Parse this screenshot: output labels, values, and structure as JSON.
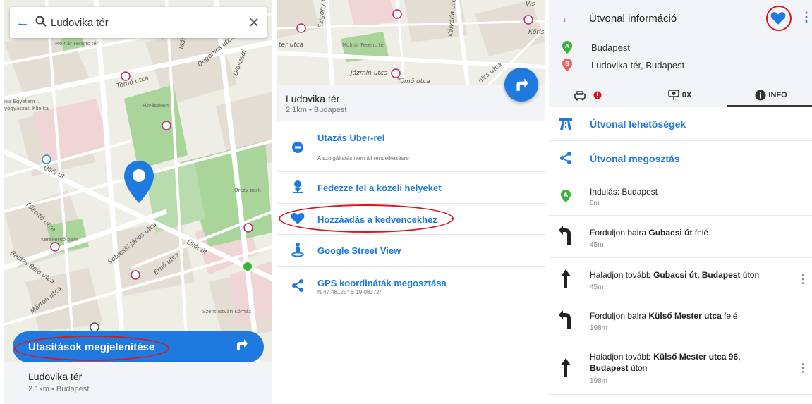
{
  "colors": {
    "accent": "#1f7ae0",
    "highlight": "#e0141c",
    "marker_a": "#3bb33b",
    "marker_b": "#f0605e"
  },
  "panel1": {
    "search": {
      "query": "Ludovika tér",
      "back_icon": "arrow-left-icon",
      "search_icon": "magnifier-icon",
      "clear_icon": "close-icon"
    },
    "map_labels": {
      "streets": [
        "Illés utca",
        "Dugonics utca",
        "Diószegi",
        "Tömő utca",
        "Üllői út",
        "Tűzoltó utca",
        "Balázs Béla utca",
        "Sobieski János utca",
        "Ernő utca",
        "Márton utca",
        "Üllői út",
        "Mária utca"
      ],
      "pois": [
        "Molnár Ferenc tér",
        "Füvészkert",
        "Orczy park",
        "Kerekerdő park",
        "Szent István Kórház",
        "ika Egyetem I.",
        "yógyászati Klinika"
      ]
    },
    "cta_label": "Utasítások megjelenítése",
    "cta_icon": "turn-right-icon",
    "place": {
      "title": "Ludovika tér",
      "subtitle": "2.1km • Budapest"
    }
  },
  "panel2": {
    "map_labels": [
      "Szigony u",
      "Kőris",
      "Vis",
      "ter utca",
      "Molnár Ferenc tér",
      "Kálvária utca",
      "Jázmin utca",
      "Tömő utca",
      "olcs utca"
    ],
    "place": {
      "title": "Ludovika tér",
      "subtitle": "2.1km • Budapest"
    },
    "fab_icon": "turn-right-icon",
    "menu": [
      {
        "label": "Utazás Uber-rel",
        "sub": "A szolgáltatás nem áll rendelkezésre",
        "icon": "uber-icon"
      },
      {
        "label": "Fedezze fel a közeli helyeket",
        "sub": "",
        "icon": "person-pin-icon"
      },
      {
        "label": "Hozzáadás a kedvencekhez",
        "sub": "",
        "icon": "heart-icon"
      },
      {
        "label": "Google Street View",
        "sub": "",
        "icon": "street-view-icon"
      },
      {
        "label": "GPS koordináták megosztása",
        "sub": "N 47.48125° E 19.08372°",
        "icon": "share-icon"
      }
    ]
  },
  "panel3": {
    "title": "Útvonal információ",
    "from": {
      "marker": "A",
      "text": "Budapest"
    },
    "to": {
      "marker": "B",
      "text": "Ludovika tér, Budapest"
    },
    "tabs": [
      {
        "icon": "car-traffic-icon",
        "badge_icon": "alert-icon"
      },
      {
        "icon": "speed-camera-icon",
        "label": "0X"
      },
      {
        "icon": "info-icon",
        "label": "INFO"
      }
    ],
    "options": [
      {
        "label": "Útvonal lehetőségek",
        "icon": "highway-icon"
      },
      {
        "label": "Útvonal megosztás",
        "icon": "share-icon"
      }
    ],
    "steps": [
      {
        "pre": "Indulás: Budapest",
        "bold": "",
        "post": "",
        "dist": "0m",
        "icon": "marker-a-icon"
      },
      {
        "pre": "Forduljon balra ",
        "bold": "Gubacsi út",
        "post": " felé",
        "dist": "45m",
        "icon": "turn-left-icon"
      },
      {
        "pre": "Haladjon tovább ",
        "bold": "Gubacsi út, Budapest",
        "post": " úton",
        "dist": "45m",
        "icon": "straight-icon"
      },
      {
        "pre": "Forduljon balra ",
        "bold": "Külső Mester utca",
        "post": " felé",
        "dist": "198m",
        "icon": "turn-left-icon"
      },
      {
        "pre": "Haladjon tovább ",
        "bold": "Külső Mester utca 96, Budapest",
        "post": " úton",
        "dist": "198m",
        "icon": "straight-icon"
      }
    ]
  }
}
